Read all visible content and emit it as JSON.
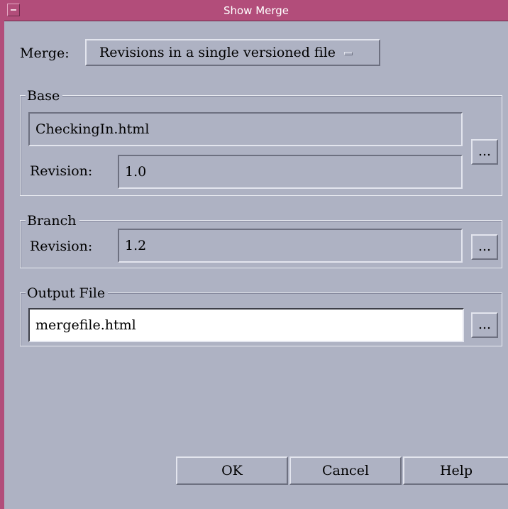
{
  "window": {
    "title": "Show Merge"
  },
  "merge": {
    "label": "Merge:",
    "selected": "Revisions in a single versioned file"
  },
  "base": {
    "group_title": "Base",
    "file_value": "CheckingIn.html",
    "revision_label": "Revision:",
    "revision_value": "1.0",
    "browse_label": "..."
  },
  "branch": {
    "group_title": "Branch",
    "revision_label": "Revision:",
    "revision_value": "1.2",
    "browse_label": "..."
  },
  "output": {
    "group_title": "Output File",
    "file_value": "mergefile.html",
    "browse_label": "..."
  },
  "buttons": {
    "ok": "OK",
    "cancel": "Cancel",
    "help": "Help"
  }
}
